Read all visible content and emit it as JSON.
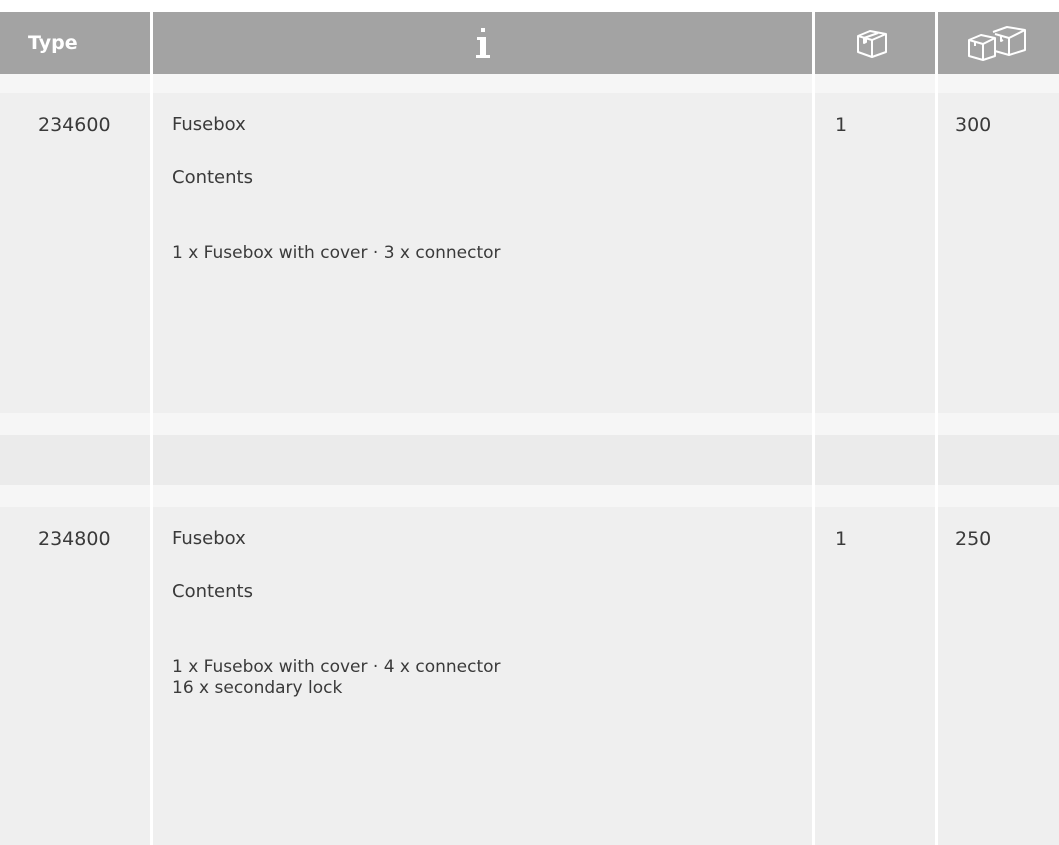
{
  "header": {
    "type_label": "Type",
    "info_icon": "info-icon",
    "package_icon": "package-icon",
    "multi_package_icon": "multi-package-icon"
  },
  "rows": [
    {
      "type": "234600",
      "name": "Fusebox",
      "contents_label": "Contents",
      "contents": "1 x Fusebox with cover · 3 x connector",
      "qty": "1",
      "pack": "300"
    },
    {
      "type": "234800",
      "name": "Fusebox",
      "contents_label": "Contents",
      "contents": "1 x Fusebox with cover · 4 x connector\n16 x secondary lock",
      "qty": "1",
      "pack": "250"
    }
  ],
  "colors": {
    "header_bg": "#a3a3a3",
    "row_bg": "#efefef",
    "text": "#3a3a3a"
  }
}
